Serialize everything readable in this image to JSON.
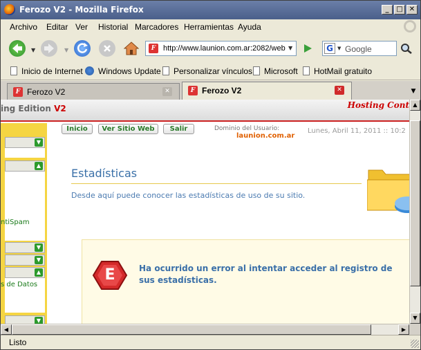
{
  "window": {
    "title": "Ferozo V2 - Mozilla Firefox"
  },
  "menu": [
    "Archivo",
    "Editar",
    "Ver",
    "Historial",
    "Marcadores",
    "Herramientas",
    "Ayuda"
  ],
  "nav": {
    "url": "http://www.launion.com.ar:2082/web",
    "search_placeholder": "Google"
  },
  "bookmarks": [
    "Inicio de Internet",
    "Windows Update",
    "Personalizar vínculos",
    "Microsoft",
    "HotMail gratuito"
  ],
  "tabs": [
    {
      "label": "Ferozo V2",
      "active": false
    },
    {
      "label": "Ferozo V2",
      "active": true
    }
  ],
  "page": {
    "header_left_prefix": "ing Edition ",
    "header_left_v2": "V2",
    "header_right": "Hosting Cont",
    "buttons": [
      "Inicio",
      "Ver Sitio Web",
      "Salir"
    ],
    "domain_label": "Dominio del Usuario:",
    "domain_value": "launion.com.ar",
    "date": "Lunes, Abril 11, 2011 :: 10:2",
    "title": "Estadísticas",
    "description": "Desde aquí puede conocer las estadísticas de uso de su sitio.",
    "error_letter": "E",
    "error_message": "Ha ocurrido un error al intentar acceder al registro de sus estadísticas.",
    "sidebar_texts": [
      "ntiSpam",
      "s de Datos"
    ]
  },
  "status": {
    "text": "Listo"
  },
  "colors": {
    "accent_red": "#cc2222",
    "link_blue": "#3a70a8",
    "sidebar_yellow": "#f5d542",
    "green": "#2c9a2c"
  }
}
